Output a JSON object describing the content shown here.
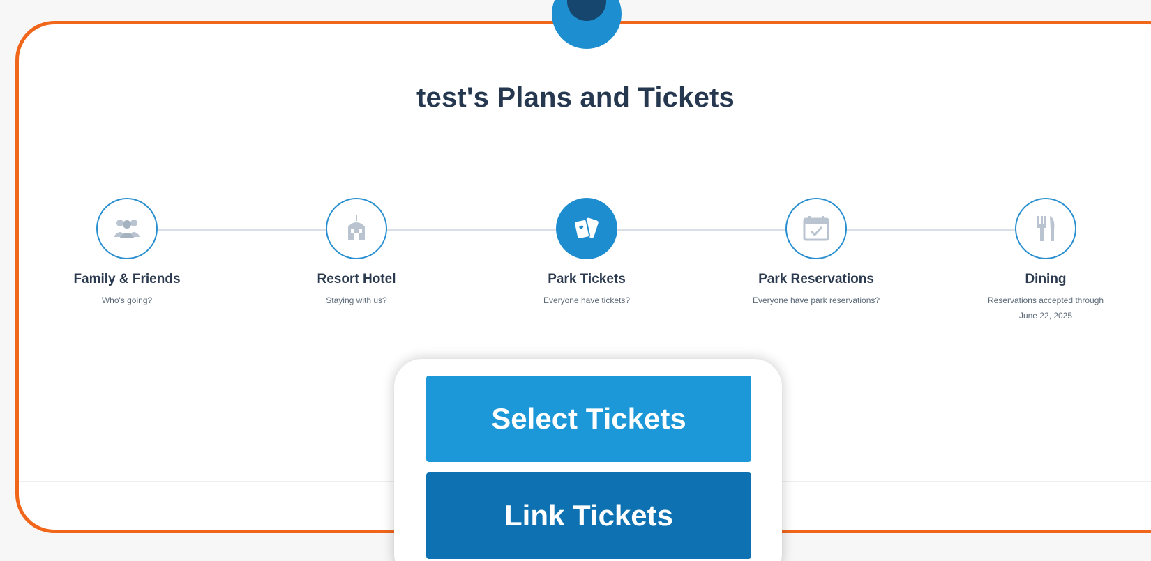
{
  "page": {
    "title": "test's Plans and Tickets"
  },
  "steps": [
    {
      "label": "Family & Friends",
      "sub": "Who's going?",
      "icon": "people-icon",
      "active": false
    },
    {
      "label": "Resort Hotel",
      "sub": "Staying with us?",
      "icon": "hotel-icon",
      "active": false
    },
    {
      "label": "Park Tickets",
      "sub": "Everyone have tickets?",
      "icon": "tickets-icon",
      "active": true
    },
    {
      "label": "Park Reservations",
      "sub": "Everyone have park reservations?",
      "icon": "calendar-check-icon",
      "active": false
    },
    {
      "label": "Dining",
      "sub": "Reservations accepted through June 22, 2025",
      "icon": "fork-knife-icon",
      "active": false
    }
  ],
  "actions": {
    "select_label": "Select Tickets",
    "link_label": "Link Tickets"
  },
  "colors": {
    "accent_orange": "#f0671c",
    "primary_blue": "#1c98d9",
    "dark_blue": "#0e72b2",
    "heading": "#26384f"
  }
}
